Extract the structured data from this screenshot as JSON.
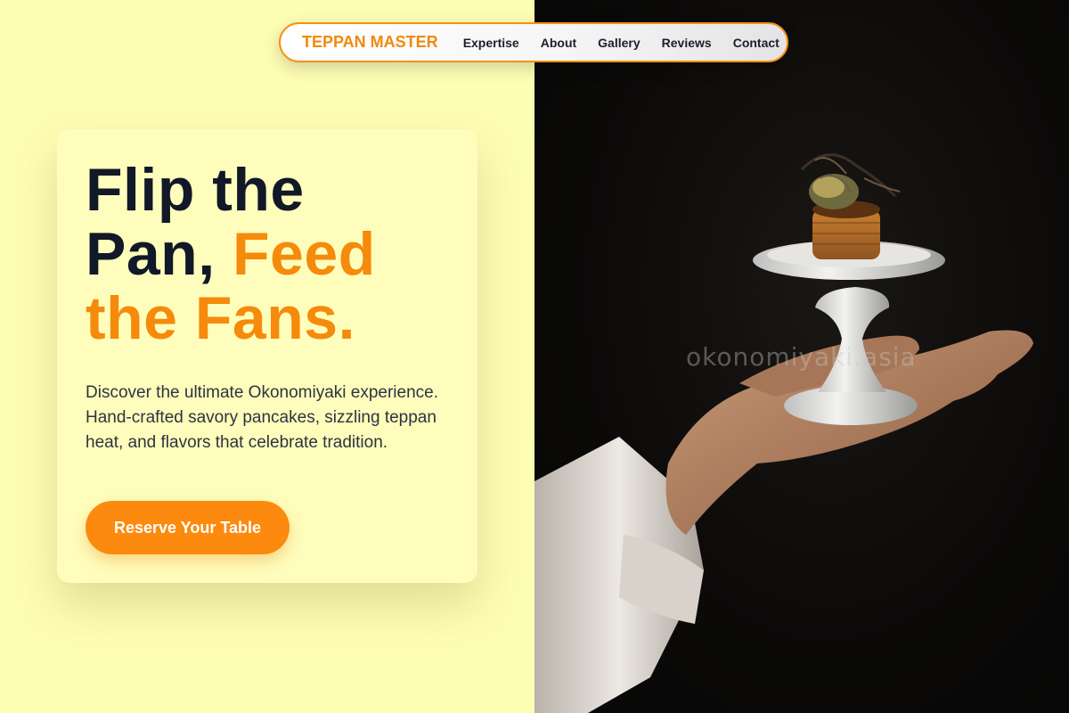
{
  "nav": {
    "brand": "TEPPAN MASTER",
    "links": [
      "Expertise",
      "About",
      "Gallery",
      "Reviews",
      "Contact"
    ]
  },
  "hero": {
    "headline_part1": "Flip the Pan,",
    "headline_accent": "Feed the Fans.",
    "description": "Discover the ultimate Okonomiyaki experience. Hand-crafted savory pancakes, sizzling teppan heat, and flavors that celebrate tradition.",
    "cta_label": "Reserve Your Table"
  },
  "image": {
    "watermark": "okonomiyaki.asia"
  },
  "colors": {
    "accent": "#f58a0b",
    "background": "#fefdb4",
    "text_dark": "#111827"
  }
}
